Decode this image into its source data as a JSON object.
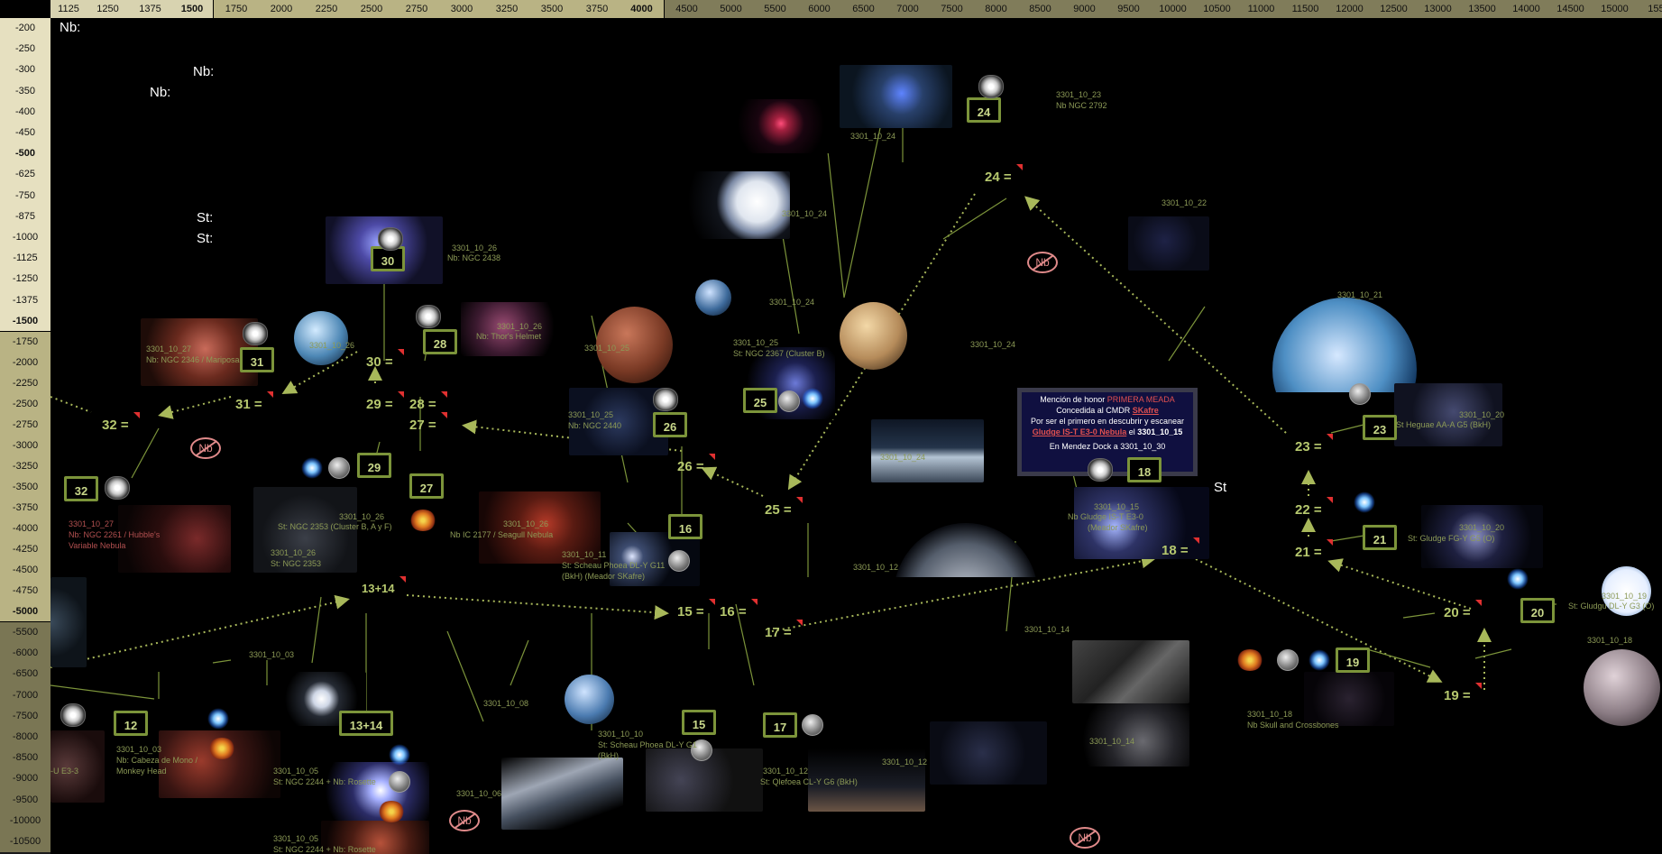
{
  "header": {
    "cells": [
      "1125",
      "1250",
      "1375",
      "1500",
      "1750",
      "2000",
      "2250",
      "2500",
      "2750",
      "3000",
      "3250",
      "3500",
      "3750",
      "4000",
      "4500",
      "5000",
      "5500",
      "6000",
      "6500",
      "7000",
      "7500",
      "8000",
      "8500",
      "9000",
      "9500",
      "10000",
      "10500",
      "11000",
      "11500",
      "12000",
      "12500",
      "13000",
      "13500",
      "14000",
      "14500",
      "15000",
      "1550"
    ],
    "bold": [
      "1500",
      "4000"
    ]
  },
  "side": {
    "cells": [
      "-200",
      "-250",
      "-300",
      "-350",
      "-400",
      "-450",
      "-500",
      "-625",
      "-750",
      "-875",
      "-1000",
      "-1125",
      "-1250",
      "-1375",
      "-1500",
      "-1750",
      "-2000",
      "-2250",
      "-2500",
      "-2750",
      "-3000",
      "-3250",
      "-3500",
      "-3750",
      "-4000",
      "-4250",
      "-4500",
      "-4750",
      "-5000",
      "-5500",
      "-6000",
      "-6500",
      "-7000",
      "-7500",
      "-8000",
      "-8500",
      "-9000",
      "-9500",
      "-10000",
      "-10500"
    ],
    "bold": [
      "-500",
      "-1500",
      "-5000"
    ]
  },
  "labels": {
    "nb1": "Nb:",
    "nb2": "Nb:",
    "nb3": "Nb:",
    "st1": "St:",
    "st2": "St:",
    "st3": "St"
  },
  "nodes": {
    "n13_14": "13+14",
    "n15": "15 =",
    "n16": "16 =",
    "n17": "17 =",
    "n18": "18 =",
    "n19": "19 =",
    "n20": "20 =",
    "n21": "21 =",
    "n22": "22 =",
    "n23": "23 =",
    "n24": "24 =",
    "n25": "25 =",
    "n26": "26 =",
    "n27": "27 =",
    "n28": "28 =",
    "n29": "29 =",
    "n30": "30 =",
    "n31": "31 =",
    "n32": "32 ="
  },
  "boxes": {
    "b12": "12",
    "b13_14": "13+14",
    "b15": "15",
    "b16": "16",
    "b17": "17",
    "b18": "18",
    "b19": "19",
    "b20": "20",
    "b21": "21",
    "b23": "23",
    "b24": "24",
    "b25": "25",
    "b26": "26",
    "b27": "27",
    "b28": "28",
    "b29": "29",
    "b30": "30",
    "b31": "31",
    "b32": "32"
  },
  "captions": {
    "c24a": "3301_10_24",
    "c24b": "3301_10_23",
    "c24c": "Nb NGC 2792",
    "c24d": "3301_10_24",
    "c24e": "3301_10_24",
    "c24f": "3301_10_24",
    "c22": "3301_10_22",
    "c26a": "3301_10_26",
    "c26b": "Nb: NGC 2438",
    "c27a": "3301_10_27",
    "c27b": "Nb: NGC 2346 / Mariposa",
    "c26c": "3301_10_26",
    "c26d": "3301_10_26",
    "c26e": "Nb: Thor's Helmet",
    "c25a": "3301_10_25",
    "c25b": "3301_10_25",
    "c25c": "St: NGC 2367 (Cluster B)",
    "c24g": "3301_10_24",
    "c21": "3301_10_21",
    "c25d": "3301_10_25",
    "c25e": "Nb: NGC 2440",
    "c20a": "3301_10_20",
    "c20b": "St Heguae AA-A G5 (BkH)",
    "c27c": "3301_10_27",
    "c27d": "Nb: NGC 2261 / Hubble's",
    "c27e": "Variable Nebula",
    "c26f": "3301_10_26",
    "c26g": "St: NGC 2353 (Cluster  B, A y F)",
    "c26h": "3301_10_26",
    "c26i": "St: NGC 2353",
    "c26j": "3301_10_26",
    "c26k": "Nb IC 2177 / Seagull Nebula",
    "c11a": "3301_10_11",
    "c11b": "St: Scheau Phoea DL-Y G11",
    "c11c": "(BkH) (Meador SKafre)",
    "c15a": "3301_10_15",
    "c15b": "Nb Gludge IS-T E3-0",
    "c15c": "(Meador SKafre)",
    "c12a": "3301_10_12",
    "c20c": "3301_10_20",
    "c20d": "St: Gludge FG-Y G5 (O)",
    "c19a": "3301_10_19",
    "c19b": "St: Gludgu DL-Y G3 (O)",
    "c03a": "3301_10_03",
    "c18a": "3301_10_18",
    "c14a": "3301_10_14",
    "c14b": "3301_10_14",
    "c08a": "3301_10_08",
    "c18b": "3301_10_18",
    "c18c": "Nb Skull and Crossbones",
    "c03b": "3301_10_03",
    "c03c": "Nb: Cabeza de Mono /",
    "c03d": "Monkey Head",
    "e33": "-U E3-3",
    "c10a": "3301_10_10",
    "c10b": "St: Scheau Phoea DL-Y G1",
    "c10c": "(BkH)",
    "c12b": "3301_10_12",
    "c12c": "St: Qlefoea CL-Y G6 (BkH)",
    "c12d": "3301_10_12",
    "c05a": "3301_10_05",
    "c05b": "St: NGC 2244  +  Nb: Rosette",
    "c06a": "3301_10_06",
    "c05c": "3301_10_05",
    "c05d": "St: NGC 2244  +  Nb: Rosette"
  },
  "forbid": {
    "f1": "Nb",
    "f2": "Nb",
    "f3": "Nb",
    "f4": "Nb"
  },
  "honor": {
    "l1a": "Mención de honor ",
    "l1b": "PRIMERA MEADA",
    "l2a": "Concedida al CMDR ",
    "l2b": "SKafre",
    "l3": "Por ser el primero en descubrir y escanear",
    "l4a": "Gludge IS-T E3-0 Nebula",
    "l4b": " el ",
    "l4c": "3301_10_15",
    "l5": "En  Mendez Dock a 3301_10_30"
  },
  "colors": {
    "node": "#b6c86e",
    "box": "#7c943a",
    "link": "#a8b85a",
    "accent_red": "#e03030"
  }
}
